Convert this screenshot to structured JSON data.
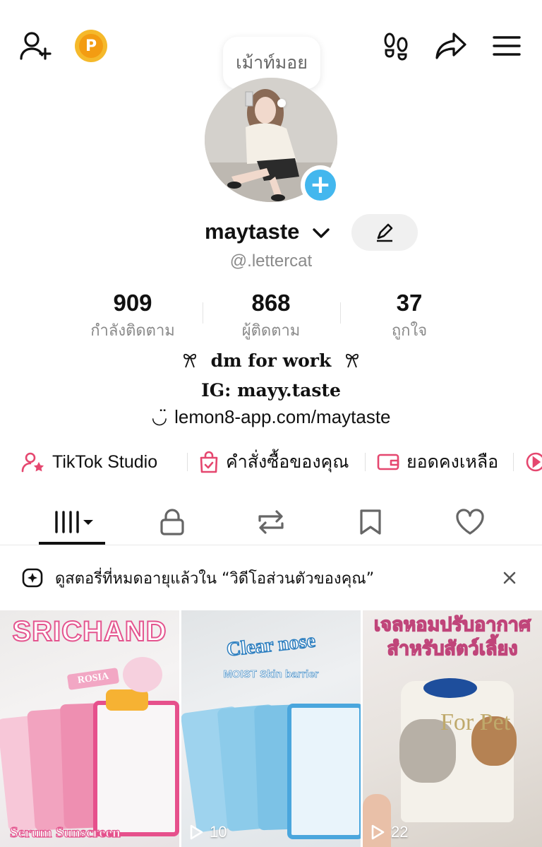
{
  "header": {
    "bubble_text": "เม้าท์มอย",
    "coin_letter": "P"
  },
  "profile": {
    "display_name": "maytaste",
    "handle": "@.lettercat"
  },
  "stats": [
    {
      "value": "909",
      "label": "กำลังติดตาม"
    },
    {
      "value": "868",
      "label": "ผู้ติดตาม"
    },
    {
      "value": "37",
      "label": "ถูกใจ"
    }
  ],
  "bio": {
    "line1": "🎀 dm for work 🎀",
    "line1_text": "dm for work",
    "line2": "IG: mayy.taste",
    "line3_link": "lemon8-app.com/maytaste",
    "line3_icon": "◡̈"
  },
  "shortcuts": [
    {
      "label": "TikTok Studio",
      "icon": "user-star-icon"
    },
    {
      "label": "คำสั่งซื้อของคุณ",
      "icon": "shopping-bag-icon"
    },
    {
      "label": "ยอดคงเหลือ",
      "icon": "wallet-icon"
    }
  ],
  "tabs": [
    "videos",
    "private",
    "reposts",
    "saved",
    "liked"
  ],
  "banner": {
    "text": "ดูสตอรี่ที่หมดอายุแล้วใน “วิดีโอส่วนตัวของคุณ”"
  },
  "videos": [
    {
      "headline": "SRICHAND",
      "sub": "ROSIA",
      "caption": "Serum Sunscreen",
      "views": ""
    },
    {
      "headline": "Clear nose",
      "sub": "MOIST Skin barrier",
      "views": "10"
    },
    {
      "headline": "เจลหอมปรับอากาศ สำหรับสัตว์เลี้ยง",
      "sub": "For Pet",
      "views": "22"
    }
  ],
  "colors": {
    "accent_pink": "#e5476f",
    "avatar_plus": "#43b7ee",
    "coin": "#f5b92b"
  }
}
